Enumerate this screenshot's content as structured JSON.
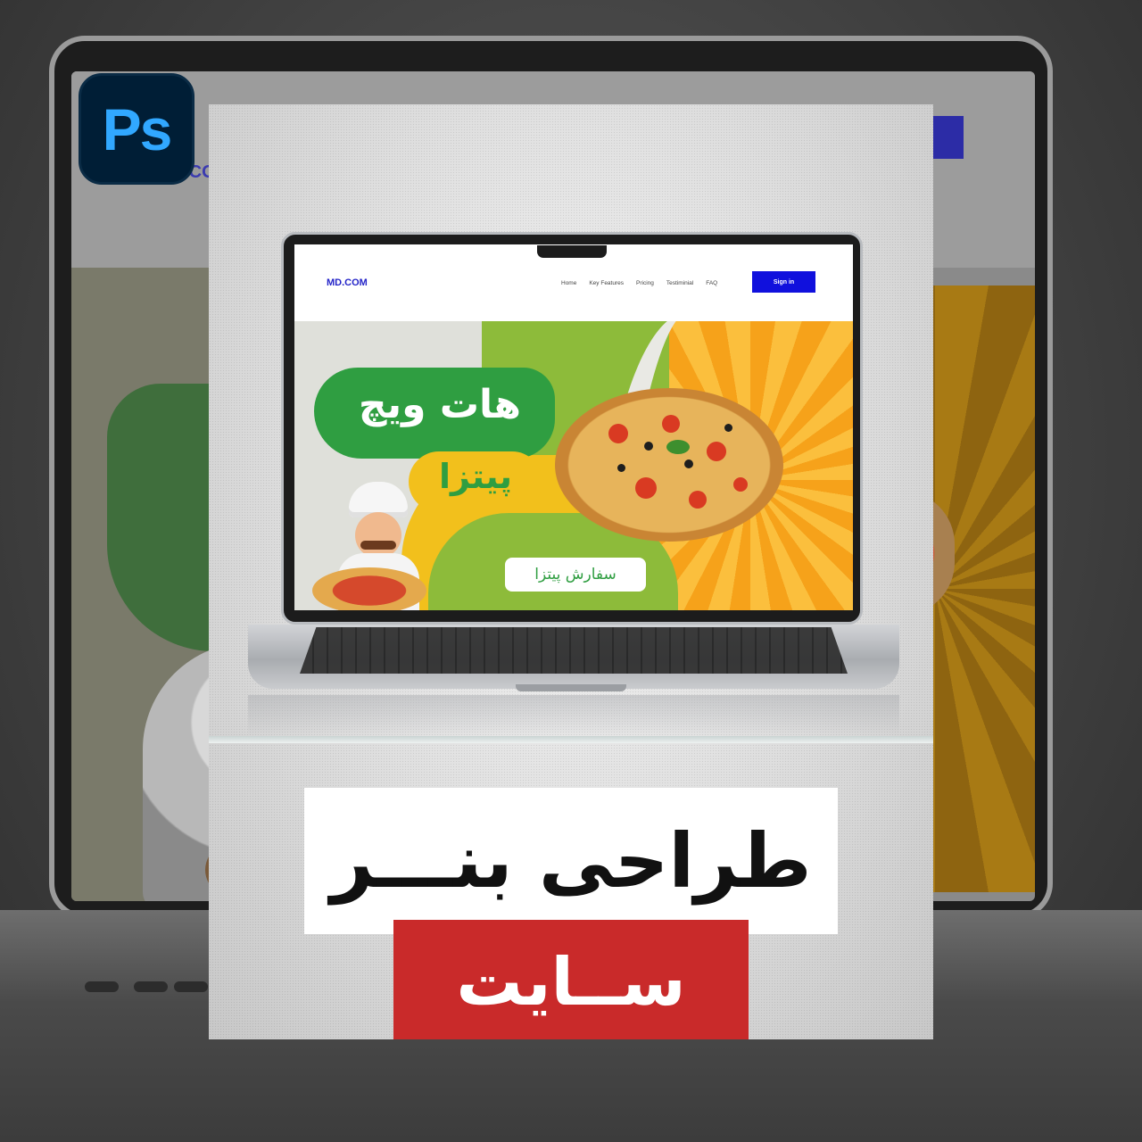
{
  "badge": {
    "label": "Ps",
    "color": "#31a8ff",
    "background": "#001e36"
  },
  "background_site": {
    "logo_text": "MD.COM"
  },
  "mockup_site": {
    "logo": "MD.COM",
    "nav": [
      "Home",
      "Key Features",
      "Pricing",
      "Testiminial",
      "FAQ"
    ],
    "signin_label": "Sign in",
    "accent_color": "#1010dd"
  },
  "banner": {
    "title": "هات ویچ",
    "subtitle": "پیتزا",
    "cta_label": "سفارش پیتزا",
    "colors": {
      "green": "#2f9e41",
      "yellow": "#f2c01c",
      "orange": "#f6a21a"
    }
  },
  "headline": {
    "title": "طراحی بنـــر",
    "subtitle": "ســایت",
    "subtitle_bg": "#c92a2a"
  }
}
